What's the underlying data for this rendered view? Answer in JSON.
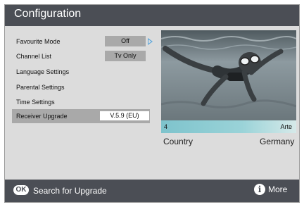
{
  "header": {
    "title": "Configuration"
  },
  "menu": {
    "items": [
      {
        "label": "Favourite Mode",
        "value": "Off"
      },
      {
        "label": "Channel List",
        "value": "Tv Only"
      },
      {
        "label": "Language Settings"
      },
      {
        "label": "Parental Settings"
      },
      {
        "label": "Time Settings"
      },
      {
        "label": "Receiver Upgrade",
        "value": "V.5.9 (EU)"
      }
    ],
    "selected_index": 5
  },
  "preview": {
    "channel_number": "4",
    "channel_name": "Arte"
  },
  "info": {
    "country_label": "Country",
    "country_value": "Germany"
  },
  "footer": {
    "ok_label": "OK",
    "ok_hint": "Search for Upgrade",
    "more_label": "More"
  },
  "colors": {
    "title_bar": "#4b4e55",
    "panel": "#dcdcdc",
    "highlight": "#a9a9a9",
    "accent": "#5aa6dc",
    "channel_bar": "#9ad3d8"
  },
  "icons": [
    "arrow-right-icon",
    "info-icon"
  ]
}
